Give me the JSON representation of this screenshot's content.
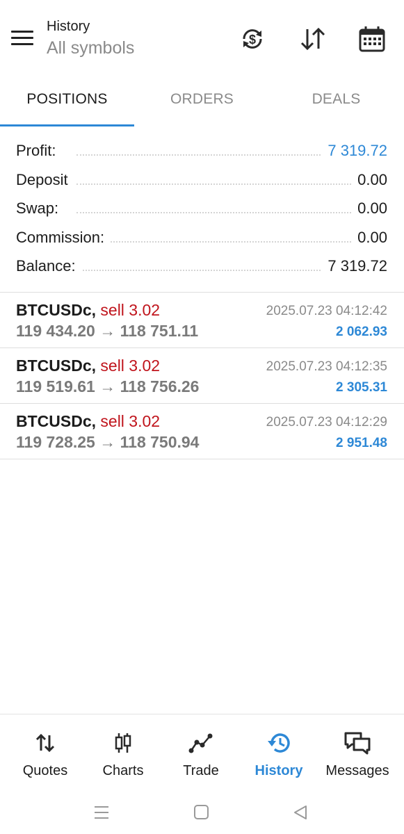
{
  "header": {
    "title": "History",
    "subtitle": "All symbols",
    "icons": [
      "menu-icon",
      "currency-exchange-icon",
      "sort-icon",
      "calendar-icon"
    ]
  },
  "tabs": [
    {
      "label": "POSITIONS",
      "active": true
    },
    {
      "label": "ORDERS",
      "active": false
    },
    {
      "label": "DEALS",
      "active": false
    }
  ],
  "summary": [
    {
      "label": "Profit:",
      "value": "7 319.72"
    },
    {
      "label": "Deposit",
      "value": "0.00"
    },
    {
      "label": "Swap:",
      "value": "0.00"
    },
    {
      "label": "Commission:",
      "value": "0.00"
    },
    {
      "label": "Balance:",
      "value": "7 319.72"
    }
  ],
  "positions": [
    {
      "symbol": "BTCUSDc,",
      "side": "sell 3.02",
      "prices": "119 434.20 → 118 751.11",
      "time": "2025.07.23 04:12:42",
      "profit": "2 062.93"
    },
    {
      "symbol": "BTCUSDc,",
      "side": "sell 3.02",
      "prices": "119 519.61 → 118 756.26",
      "time": "2025.07.23 04:12:35",
      "profit": "2 305.31"
    },
    {
      "symbol": "BTCUSDc,",
      "side": "sell 3.02",
      "prices": "119 728.25 → 118 750.94",
      "time": "2025.07.23 04:12:29",
      "profit": "2 951.48"
    }
  ],
  "bottom_nav": [
    {
      "label": "Quotes",
      "icon": "quotes-icon",
      "active": false
    },
    {
      "label": "Charts",
      "icon": "candlestick-icon",
      "active": false
    },
    {
      "label": "Trade",
      "icon": "trade-icon",
      "active": false
    },
    {
      "label": "History",
      "icon": "history-icon",
      "active": true
    },
    {
      "label": "Messages",
      "icon": "messages-icon",
      "active": false
    }
  ],
  "colors": {
    "accent": "#2d88d6",
    "sell": "#c0141c",
    "muted": "#8a8a8a"
  }
}
